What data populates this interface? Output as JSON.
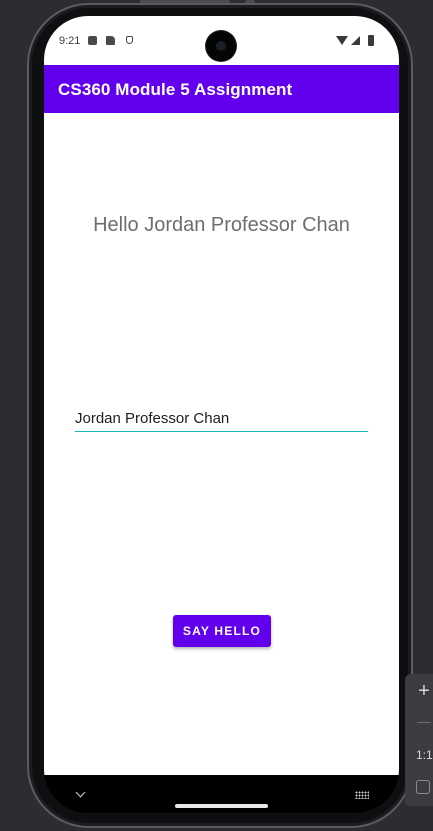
{
  "status_bar": {
    "time": "9:21"
  },
  "app_bar": {
    "title": "CS360 Module 5 Assignment"
  },
  "main": {
    "greeting": "Hello Jordan Professor Chan",
    "name_input": {
      "value": "Jordan Professor Chan"
    },
    "say_hello_button": "SAY HELLO"
  },
  "emulator_toolbar": {
    "zoom_in": "+",
    "zoom_ratio": "1:1"
  },
  "colors": {
    "primary": "#6200ee",
    "input_underline": "#18b4b4",
    "greeting_text": "#6e6e6e",
    "emulator_background": "#2b2d31"
  },
  "icons": {
    "status": [
      "notification-a-icon",
      "sd-card-icon",
      "shield-icon",
      "wifi-icon",
      "signal-icon",
      "battery-icon"
    ],
    "nav": [
      "chevron-down-icon",
      "home-pill",
      "keyboard-icon"
    ]
  }
}
